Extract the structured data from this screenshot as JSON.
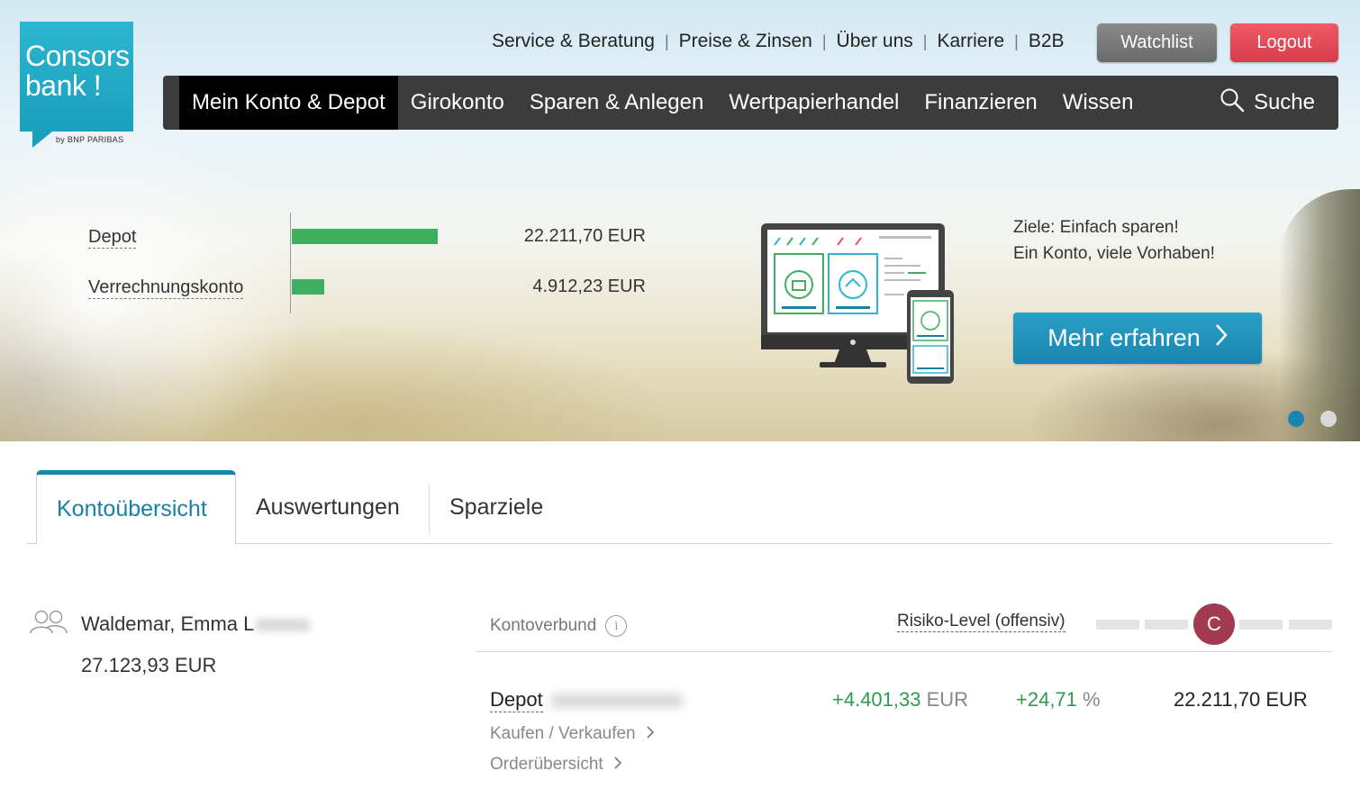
{
  "brand": {
    "logo_line1": "Consors",
    "logo_line2": "bank !",
    "logo_by": "by BNP PARIBAS",
    "color": "#1a9fbd"
  },
  "top_links": [
    "Service & Beratung",
    "Preise & Zinsen",
    "Über uns",
    "Karriere",
    "B2B"
  ],
  "buttons": {
    "watchlist": "Watchlist",
    "logout": "Logout"
  },
  "nav": {
    "items": [
      "Mein Konto & Depot",
      "Girokonto",
      "Sparen & Anlegen",
      "Wertpapierhandel",
      "Finanzieren",
      "Wissen"
    ],
    "active_index": 0,
    "search": "Suche",
    "search_icon": "search-icon"
  },
  "hero": {
    "accounts": [
      {
        "label": "Depot",
        "value": "22.211,70 EUR",
        "amount": 22211.7
      },
      {
        "label": "Verrechnungskonto",
        "value": "4.912,23 EUR",
        "amount": 4912.23
      }
    ],
    "bar_color": "#3fae5f",
    "promo_line1": "Ziele: Einfach sparen!",
    "promo_line2": "Ein Konto, viele Vorhaben!",
    "cta": "Mehr erfahren",
    "slides": 2,
    "active_slide": 0
  },
  "tabs": {
    "items": [
      "Kontoübersicht",
      "Auswertungen",
      "Sparziele"
    ],
    "active_index": 0
  },
  "owner": {
    "name": "Waldemar, Emma L",
    "total": "27.123,93 EUR",
    "icon": "users-icon"
  },
  "kontoverbund": {
    "label": "Kontoverbund",
    "risk_label": "Risiko-Level (offensiv)",
    "risk_badge": "C",
    "risk_color": "#a23a52",
    "depot": {
      "name": "Depot",
      "change_abs": "+4.401,33",
      "change_abs_unit": "EUR",
      "change_pct": "+24,71",
      "change_pct_unit": "%",
      "total": "22.211,70 EUR",
      "links": [
        "Kaufen / Verkaufen",
        "Orderübersicht"
      ]
    }
  }
}
